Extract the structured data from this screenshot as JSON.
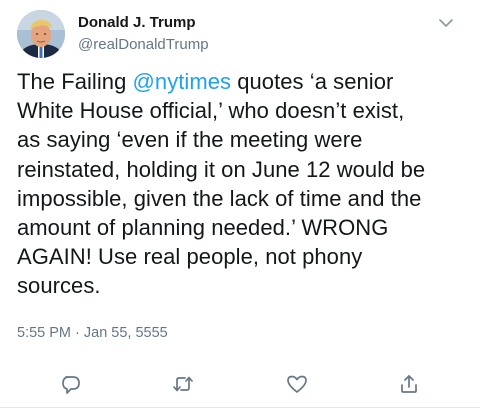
{
  "tweet": {
    "author": {
      "display_name": "Donald J. Trump",
      "handle": "@realDonaldTrump"
    },
    "text_before_mention": "The Failing ",
    "mention": "@nytimes",
    "text_after_mention": " quotes ‘a senior\nWhite House official,’ who doesn’t exist,\nas saying ‘even if the meeting were\nreinstated, holding it on June 12 would be\nimpossible, given the lack of time and the\namount of planning needed.’ WRONG\nAGAIN! Use real people, not phony\nsources.",
    "timestamp": "5:55 PM · Jan 55, 5555"
  },
  "icons": {
    "menu": "chevron-down-icon",
    "reply": "reply-icon",
    "retweet": "retweet-icon",
    "like": "heart-icon",
    "share": "share-icon"
  },
  "colors": {
    "link": "#1da1f2",
    "secondary_text": "#657786",
    "icon": "#657786",
    "text": "#14171a"
  }
}
